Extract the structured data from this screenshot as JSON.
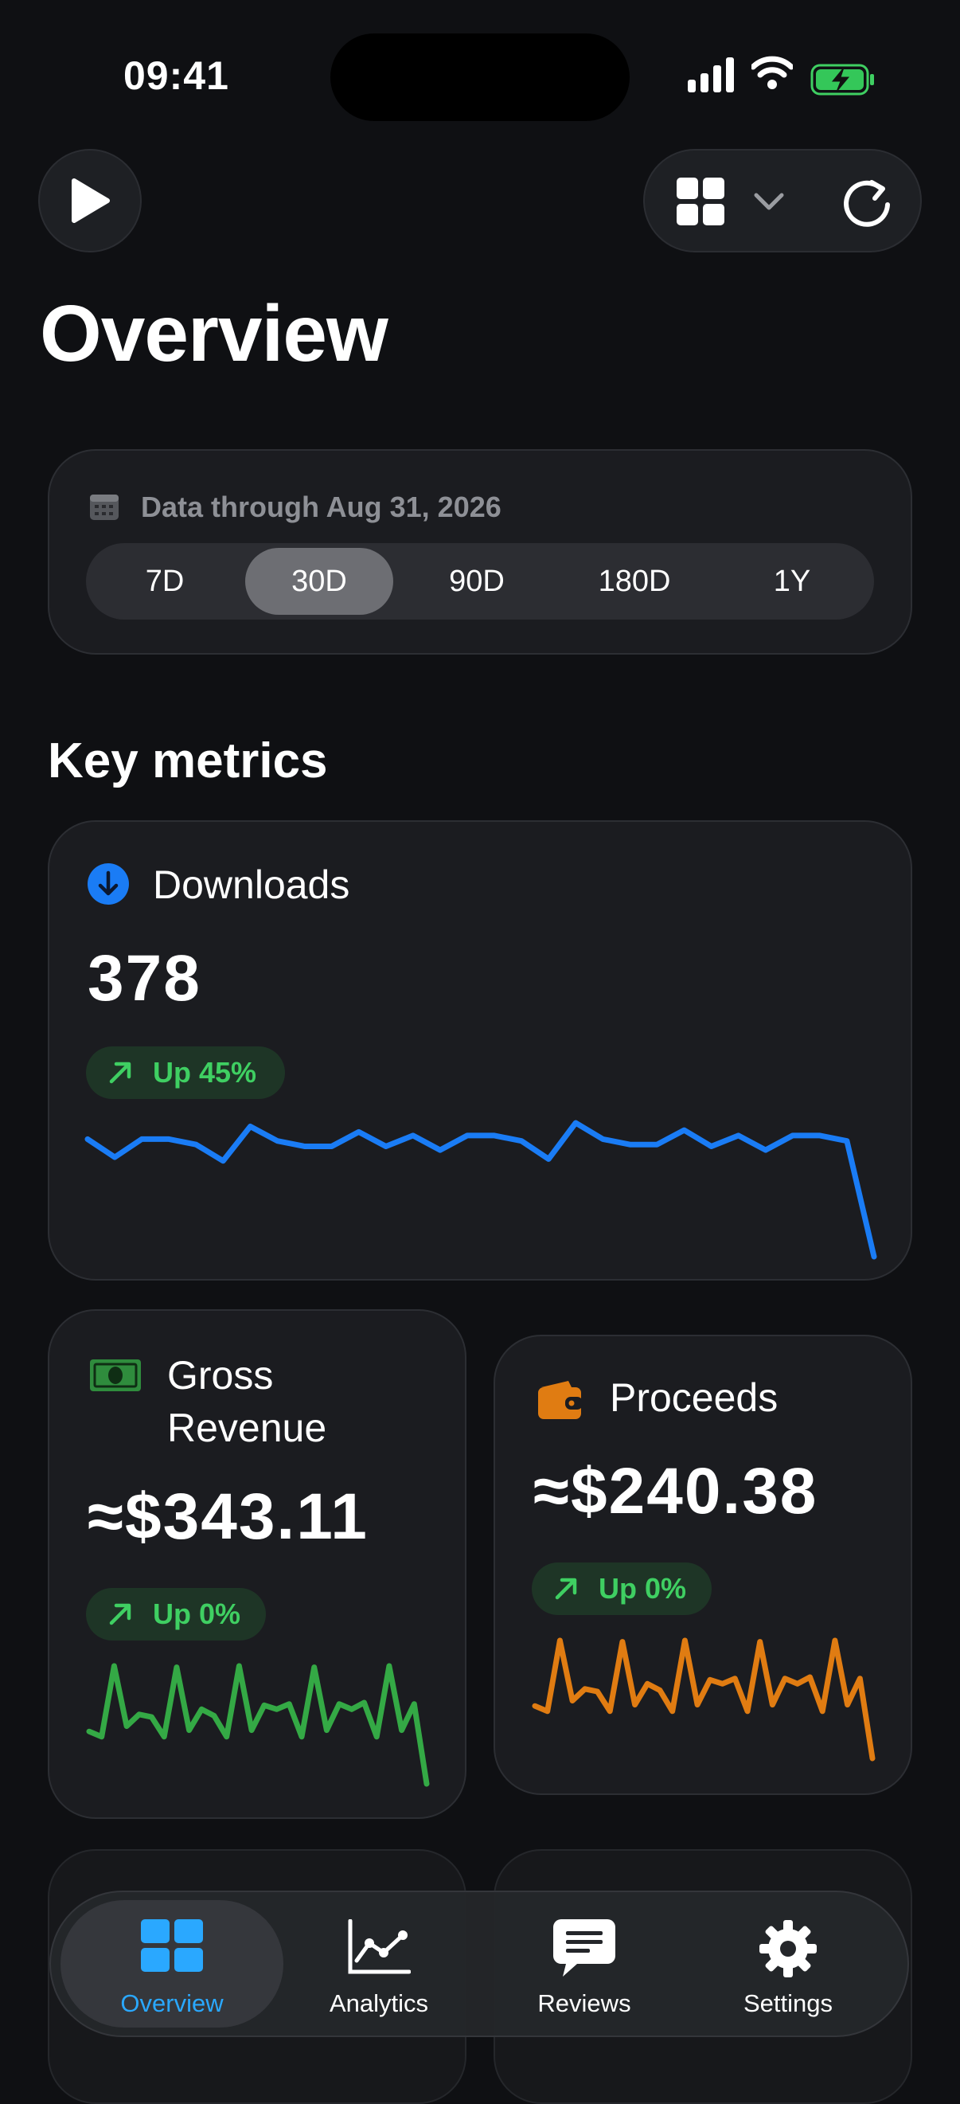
{
  "status_bar": {
    "time": "09:41"
  },
  "page": {
    "title": "Overview"
  },
  "date_range": {
    "label": "Data through Aug 31, 2026",
    "options": [
      "7D",
      "30D",
      "90D",
      "180D",
      "1Y"
    ],
    "selected": "30D"
  },
  "section_title": "Key metrics",
  "metrics": {
    "downloads": {
      "title": "Downloads",
      "value": "378",
      "trend": "Up 45%",
      "color": "#1a7cf5",
      "sparkline": [
        3,
        2,
        3,
        3,
        2.7,
        1.8,
        3.7,
        2.9,
        2.6,
        2.6,
        3.4,
        2.6,
        3.2,
        2.4,
        3.2,
        3.2,
        2.9,
        1.9,
        3.9,
        3.0,
        2.7,
        2.7,
        3.5,
        2.6,
        3.2,
        2.4,
        3.2,
        3.2,
        2.9,
        -3.5
      ]
    },
    "gross_revenue": {
      "title": "Gross Revenue",
      "value": "≈$343.11",
      "trend": "Up 0%",
      "color": "#34a945",
      "sparkline": [
        2,
        1.6,
        7.0,
        2.4,
        3.3,
        3.1,
        1.6,
        6.9,
        2.1,
        3.7,
        3.2,
        1.6,
        7.0,
        2.1,
        4.0,
        3.7,
        4.1,
        1.6,
        6.9,
        2.1,
        4.1,
        3.7,
        4.2,
        1.6,
        7.0,
        2.1,
        4.1,
        -2.0
      ]
    },
    "proceeds": {
      "title": "Proceeds",
      "value": "≈$240.38",
      "trend": "Up 0%",
      "color": "#e07c12",
      "sparkline": [
        2,
        1.6,
        7.0,
        2.4,
        3.3,
        3.1,
        1.6,
        6.9,
        2.1,
        3.7,
        3.2,
        1.6,
        7.0,
        2.1,
        4.0,
        3.7,
        4.1,
        1.6,
        6.9,
        2.1,
        4.1,
        3.7,
        4.2,
        1.6,
        7.0,
        2.1,
        4.1,
        -2.0
      ]
    }
  },
  "tabs": [
    {
      "label": "Overview",
      "icon": "grid-icon",
      "active": true
    },
    {
      "label": "Analytics",
      "icon": "chart-line-icon",
      "active": false
    },
    {
      "label": "Reviews",
      "icon": "speech-bubble-icon",
      "active": false
    },
    {
      "label": "Settings",
      "icon": "gear-icon",
      "active": false
    }
  ],
  "colors": {
    "accent": "#2aa8ff",
    "positive": "#3fcf62",
    "background": "#0f1013"
  }
}
